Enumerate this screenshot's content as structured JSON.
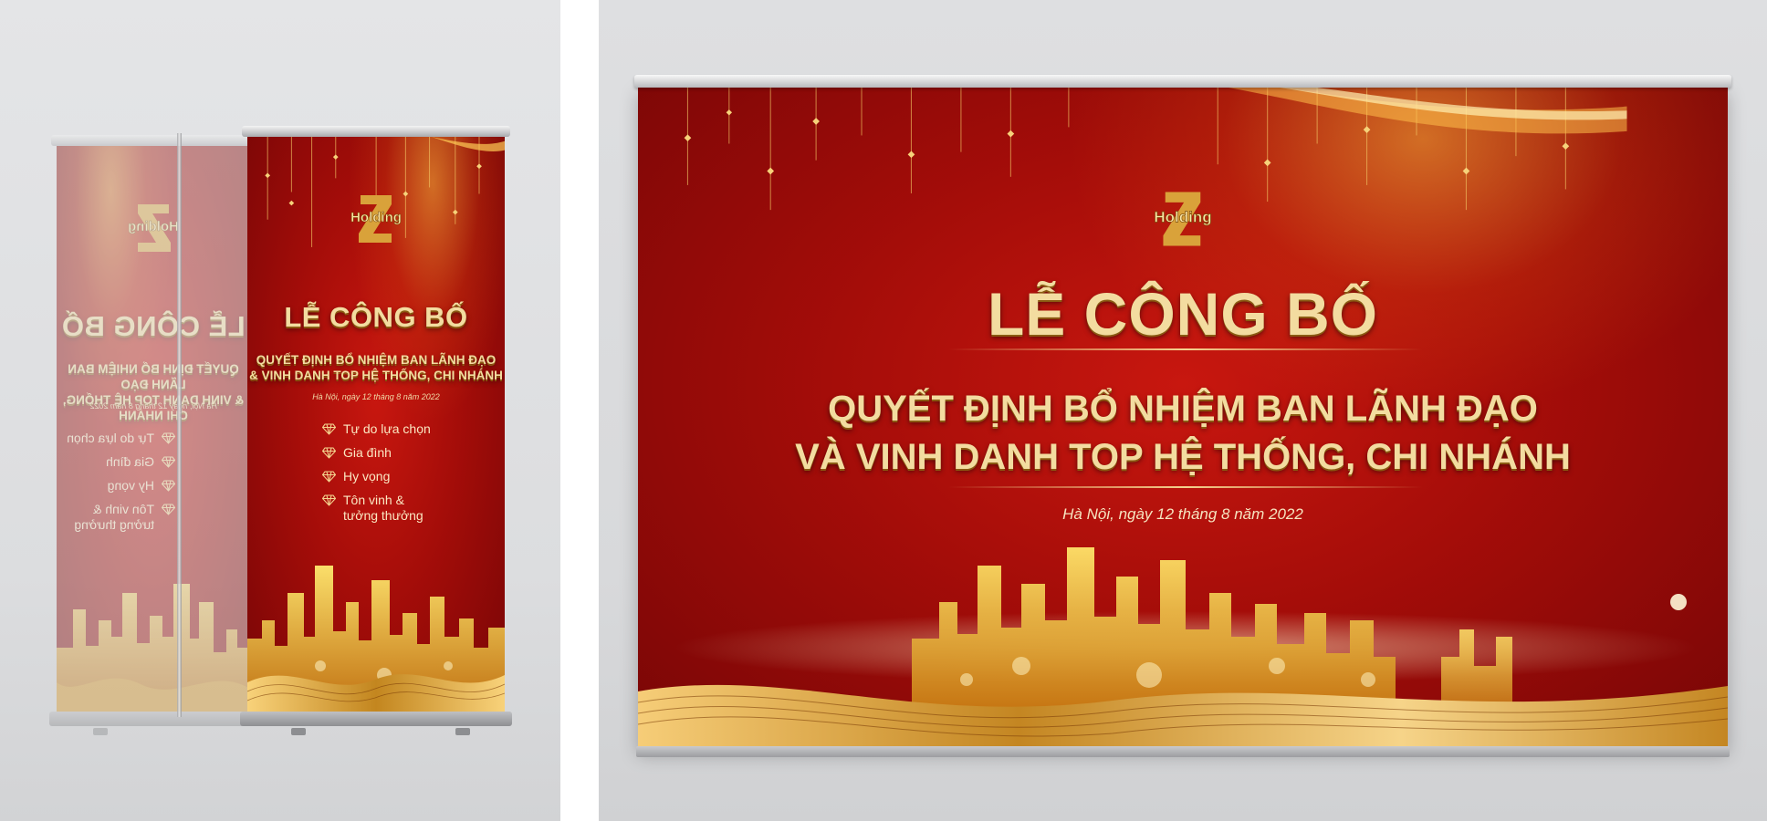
{
  "brand": {
    "logo_letter": "Z",
    "logo_word": "Holding",
    "colors": {
      "red": "#a50d09",
      "gold": "#f3dca0",
      "gold_dark": "#c8911e"
    }
  },
  "standee": {
    "title": "LỄ CÔNG BỐ",
    "subtitle_line1": "QUYẾT ĐỊNH BỔ NHIỆM BAN LÃNH ĐẠO",
    "subtitle_line2": "& VINH DANH TOP HỆ THỐNG, CHI NHÁNH",
    "date": "Hà Nội, ngày 12 tháng 8 năm 2022",
    "items": [
      {
        "icon": "diamond-icon",
        "label": "Tự do lựa chọn"
      },
      {
        "icon": "diamond-icon",
        "label": "Gia đình"
      },
      {
        "icon": "diamond-icon",
        "label": "Hy vọng"
      },
      {
        "icon": "diamond-icon",
        "label": "Tôn vinh &",
        "label2": "tưởng thưởng"
      }
    ]
  },
  "banner": {
    "title": "LỄ CÔNG BỐ",
    "subtitle_line1": "QUYẾT ĐỊNH BỔ NHIỆM BAN LÃNH ĐẠO",
    "subtitle_line2": "VÀ VINH DANH TOP HỆ THỐNG, CHI NHÁNH",
    "date": "Hà Nội, ngày 12 tháng 8 năm 2022"
  }
}
